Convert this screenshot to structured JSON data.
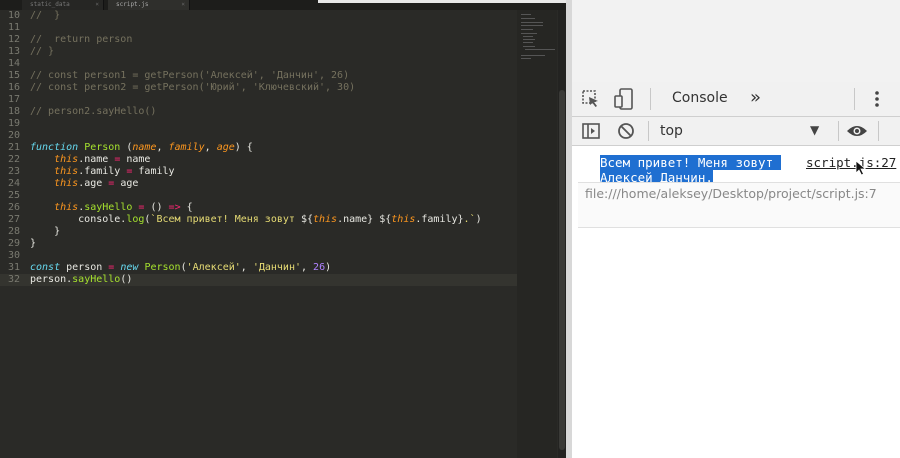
{
  "editor": {
    "tabs": [
      {
        "label": "static_data"
      },
      {
        "label": "script.js"
      }
    ],
    "lines": [
      {
        "n": "10",
        "t": "//  }"
      },
      {
        "n": "11",
        "t": ""
      },
      {
        "n": "12",
        "t": "//  return person"
      },
      {
        "n": "13",
        "t": "// }"
      },
      {
        "n": "14",
        "t": ""
      },
      {
        "n": "15",
        "t": "// const person1 = getPerson('Алексей', 'Данчин', 26)"
      },
      {
        "n": "16",
        "t": "// const person2 = getPerson('Юрий', 'Ключевский', 30)"
      },
      {
        "n": "17",
        "t": ""
      },
      {
        "n": "18",
        "t": "// person2.sayHello()"
      },
      {
        "n": "19",
        "t": ""
      },
      {
        "n": "20",
        "t": ""
      },
      {
        "n": "21",
        "t": "function Person (name, family, age) {"
      },
      {
        "n": "22",
        "t": "    this.name = name"
      },
      {
        "n": "23",
        "t": "    this.family = family"
      },
      {
        "n": "24",
        "t": "    this.age = age"
      },
      {
        "n": "25",
        "t": ""
      },
      {
        "n": "26",
        "t": "    this.sayHello = () => {"
      },
      {
        "n": "27",
        "t": "        console.log(`Всем привет! Меня зовут ${this.name} ${this.family}.`)"
      },
      {
        "n": "28",
        "t": "    }"
      },
      {
        "n": "29",
        "t": "}"
      },
      {
        "n": "30",
        "t": ""
      },
      {
        "n": "31",
        "t": "const person = new Person('Алексей', 'Данчин', 26)"
      },
      {
        "n": "32",
        "t": "person.sayHello()"
      }
    ]
  },
  "devtools": {
    "tab_console": "Console",
    "more_tabs": "»",
    "context": "top",
    "message_line1": "Всем привет! Меня зовут ",
    "message_line2": "Алексей Данчин.",
    "message_source": "script.js:27",
    "file_path": "file:///home/aleksey/Desktop/project/script.js:7"
  }
}
